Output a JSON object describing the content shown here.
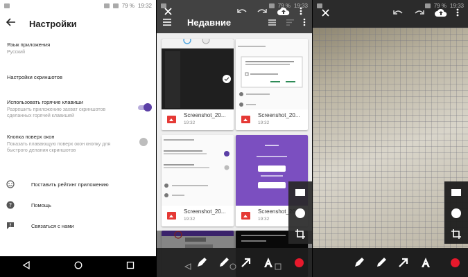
{
  "panel1": {
    "status": {
      "time": "19:32",
      "battery": "79 %"
    },
    "title": "Настройки",
    "settings": [
      {
        "title": "Язык приложения",
        "subtitle": "Русский"
      },
      {
        "title": "Настройки скриншотов",
        "subtitle": ""
      },
      {
        "title": "Использовать горячие клавиши",
        "subtitle": "Разрешить приложению захват скриншотов сделанных горячей клавишей",
        "toggle_on": true
      },
      {
        "title": "Кнопка поверх окон",
        "subtitle": "Показать плавающую поверх окон кнопку для быстрого делания скриншотов",
        "toggle_on": false
      }
    ],
    "links": [
      {
        "label": "Поставить рейтинг приложению",
        "icon": "smile-icon"
      },
      {
        "label": "Помощь",
        "icon": "help-icon"
      },
      {
        "label": "Связаться с нами",
        "icon": "feedback-icon"
      }
    ]
  },
  "panel2": {
    "status": {
      "time": "19:33",
      "battery": "79 %"
    },
    "title": "Недавние",
    "cards": [
      {
        "name": "Screenshot_20...",
        "time": "19:32"
      },
      {
        "name": "Screenshot_20...",
        "time": "19:32"
      },
      {
        "name": "Screenshot_20...",
        "time": "19:32"
      },
      {
        "name": "Screenshot_20...",
        "time": "19:32"
      }
    ]
  },
  "panel3": {
    "status": {
      "time": "19:33",
      "battery": "79 %"
    }
  },
  "colors": {
    "accent": "#5b3fa6",
    "record": "#e8192c",
    "file_icon": "#e53935"
  }
}
